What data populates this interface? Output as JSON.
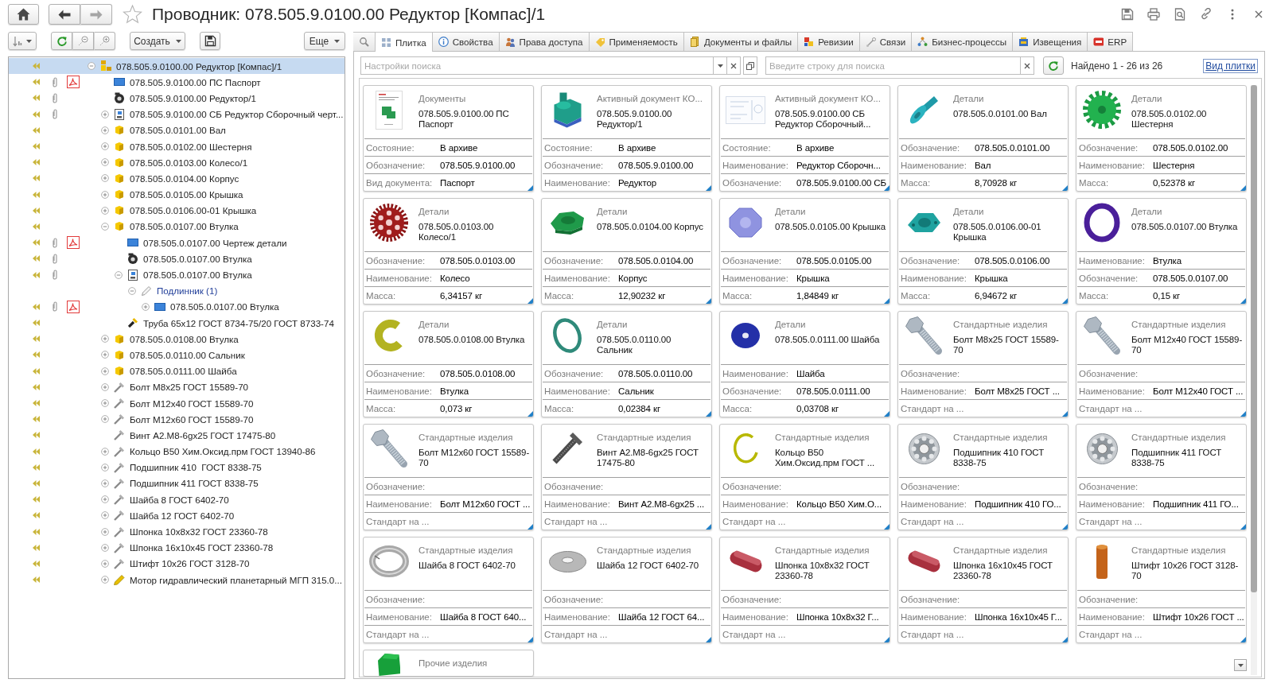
{
  "window": {
    "title": "Проводник: 078.505.9.0100.00 Редуктор [Компас]/1",
    "favorite": false
  },
  "navigation": {
    "back": {
      "disabled": false
    },
    "forward": {
      "disabled": true
    }
  },
  "tree_toolbar": {
    "create_button": "Создать",
    "more_button": "Еще"
  },
  "tree": [
    {
      "label": "078.505.9.0100.00 Редуктор [Компас]/1",
      "kind": "assembly",
      "included": true,
      "selected": true,
      "expanded": true,
      "children": [
        {
          "label": "078.505.9.0100.00 ПС Паспорт",
          "kind": "document",
          "included": true,
          "attachment": true,
          "pdf": true,
          "selected": false
        },
        {
          "label": "078.505.9.0100.00 Редуктор/1",
          "kind": "model",
          "included": true,
          "attachment": true,
          "selected": false
        },
        {
          "label": "078.505.9.0100.00 СБ Редуктор Сборочный черт...",
          "kind": "drawing",
          "included": true,
          "attachment": true,
          "expanded": false,
          "selected": false
        },
        {
          "label": "078.505.0.0101.00 Вал",
          "kind": "part",
          "included": true,
          "expanded": false,
          "selected": false
        },
        {
          "label": "078.505.0.0102.00 Шестерня",
          "kind": "part",
          "included": true,
          "expanded": false,
          "selected": false
        },
        {
          "label": "078.505.0.0103.00 Колесо/1",
          "kind": "part",
          "included": true,
          "expanded": false,
          "selected": false
        },
        {
          "label": "078.505.0.0104.00 Корпус",
          "kind": "part",
          "included": true,
          "expanded": false,
          "selected": false
        },
        {
          "label": "078.505.0.0105.00 Крышка",
          "kind": "part",
          "included": true,
          "expanded": false,
          "selected": false
        },
        {
          "label": "078.505.0.0106.00-01 Крышка",
          "kind": "part",
          "included": true,
          "expanded": false,
          "selected": false
        },
        {
          "label": "078.505.0.0107.00 Втулка",
          "kind": "part",
          "included": true,
          "expanded": true,
          "selected": false,
          "children": [
            {
              "label": "078.505.0.0107.00 Чертеж детали",
              "kind": "document",
              "included": true,
              "attachment": true,
              "pdf": true,
              "selected": false
            },
            {
              "label": "078.505.0.0107.00 Втулка",
              "kind": "model",
              "included": true,
              "attachment": true,
              "selected": false
            },
            {
              "label": "078.505.0.0107.00 Втулка",
              "kind": "drawing",
              "included": true,
              "attachment": true,
              "expanded": true,
              "selected": false,
              "children": [
                {
                  "label": "Подлинник (1)",
                  "kind": "original",
                  "included": false,
                  "expanded": true,
                  "selected": false,
                  "children": [
                    {
                      "label": "078.505.0.0107.00 Втулка",
                      "kind": "document",
                      "included": true,
                      "attachment": true,
                      "pdf": true,
                      "expanded": false,
                      "selected": false
                    }
                  ]
                }
              ]
            },
            {
              "label": "Труба 65х12 ГОСТ 8734-75/20 ГОСТ 8733-74",
              "kind": "material",
              "included": true,
              "selected": false
            }
          ]
        },
        {
          "label": "078.505.0.0108.00 Втулка",
          "kind": "part",
          "included": true,
          "expanded": false,
          "selected": false
        },
        {
          "label": "078.505.0.0110.00 Сальник",
          "kind": "part",
          "included": true,
          "expanded": false,
          "selected": false
        },
        {
          "label": "078.505.0.0111.00 Шайба",
          "kind": "part",
          "included": true,
          "expanded": false,
          "selected": false
        },
        {
          "label": "Болт М8х25 ГОСТ 15589-70",
          "kind": "standard",
          "included": true,
          "expanded": false,
          "selected": false
        },
        {
          "label": "Болт М12х40 ГОСТ 15589-70",
          "kind": "standard",
          "included": true,
          "expanded": false,
          "selected": false
        },
        {
          "label": "Болт М12х60 ГОСТ 15589-70",
          "kind": "standard",
          "included": true,
          "expanded": false,
          "selected": false
        },
        {
          "label": "Винт А2.М8-6gх25 ГОСТ 17475-80",
          "kind": "standard",
          "included": true,
          "selected": false
        },
        {
          "label": "Кольцо В50 Хим.Оксид.прм ГОСТ 13940-86",
          "kind": "standard",
          "included": true,
          "expanded": false,
          "selected": false
        },
        {
          "label": "Подшипник 410  ГОСТ 8338-75",
          "kind": "standard",
          "included": true,
          "expanded": false,
          "selected": false
        },
        {
          "label": "Подшипник 411 ГОСТ 8338-75",
          "kind": "standard",
          "included": true,
          "expanded": false,
          "selected": false
        },
        {
          "label": "Шайба 8 ГОСТ 6402-70",
          "kind": "standard",
          "included": true,
          "expanded": false,
          "selected": false
        },
        {
          "label": "Шайба 12 ГОСТ 6402-70",
          "kind": "standard",
          "included": true,
          "expanded": false,
          "selected": false
        },
        {
          "label": "Шпонка 10х8х32 ГОСТ 23360-78",
          "kind": "standard",
          "included": true,
          "expanded": false,
          "selected": false
        },
        {
          "label": "Шпонка 16х10х45 ГОСТ 23360-78",
          "kind": "standard",
          "included": true,
          "expanded": false,
          "selected": false
        },
        {
          "label": "Штифт 10х26 ГОСТ 3128-70",
          "kind": "standard",
          "included": true,
          "expanded": false,
          "selected": false
        },
        {
          "label": "Мотор гидравлический планетарный МГП 315.0...",
          "kind": "other",
          "included": true,
          "expanded": false,
          "selected": false
        }
      ]
    }
  ],
  "tabs": [
    {
      "kind": "search",
      "selected": false
    },
    {
      "kind": "tiles",
      "label": "Плитка",
      "selected": true
    },
    {
      "kind": "properties",
      "label": "Свойства",
      "selected": false
    },
    {
      "kind": "access",
      "label": "Права доступа",
      "selected": false
    },
    {
      "kind": "usage",
      "label": "Применяемость",
      "selected": false
    },
    {
      "kind": "documents",
      "label": "Документы и файлы",
      "selected": false
    },
    {
      "kind": "revisions",
      "label": "Ревизии",
      "selected": false
    },
    {
      "kind": "links",
      "label": "Связи",
      "selected": false
    },
    {
      "kind": "processes",
      "label": "Бизнес-процессы",
      "selected": false
    },
    {
      "kind": "notices",
      "label": "Извещения",
      "selected": false
    },
    {
      "kind": "erp",
      "label": "ERP",
      "selected": false
    }
  ],
  "search": {
    "settings_field": {
      "placeholder": "Настройки поиска"
    },
    "query_field": {
      "placeholder": "Введите строку для поиска"
    },
    "found": "Найдено 1 - 26 из 26",
    "view_link": "Вид плитки"
  },
  "cards": [
    {
      "kind": "passport",
      "category": "Документы",
      "title": "078.505.9.0100.00 ПС Паспорт",
      "properties": [
        {
          "label": "Состояние:",
          "value": "В архиве"
        },
        {
          "label": "Обозначение:",
          "value": "078.505.9.0100.00"
        },
        {
          "label": "Вид документа:",
          "value": "Паспорт"
        }
      ]
    },
    {
      "kind": "gearbox",
      "category": "Активный документ КО...",
      "title": "078.505.9.0100.00 Редуктор/1",
      "properties": [
        {
          "label": "Состояние:",
          "value": "В архиве"
        },
        {
          "label": "Обозначение:",
          "value": "078.505.9.0100.00"
        },
        {
          "label": "Наименование:",
          "value": "Редуктор"
        }
      ]
    },
    {
      "kind": "blueprint",
      "category": "Активный документ КО...",
      "title": "078.505.9.0100.00 СБ Редуктор Сборочный...",
      "properties": [
        {
          "label": "Состояние:",
          "value": "В архиве"
        },
        {
          "label": "Наименование:",
          "value": "Редуктор Сборочн..."
        },
        {
          "label": "Обозначение:",
          "value": "078.505.9.0100.00 СБ"
        }
      ]
    },
    {
      "kind": "shaft",
      "category": "Детали",
      "title": "078.505.0.0101.00 Вал",
      "properties": [
        {
          "label": "Обозначение:",
          "value": "078.505.0.0101.00"
        },
        {
          "label": "Наименование:",
          "value": "Вал"
        },
        {
          "label": "Масса:",
          "value": "8,70928 кг"
        }
      ]
    },
    {
      "kind": "gear",
      "category": "Детали",
      "title": "078.505.0.0102.00 Шестерня",
      "properties": [
        {
          "label": "Обозначение:",
          "value": "078.505.0.0102.00"
        },
        {
          "label": "Наименование:",
          "value": "Шестерня"
        },
        {
          "label": "Масса:",
          "value": "0,52378 кг"
        }
      ]
    },
    {
      "kind": "wheel",
      "category": "Детали",
      "title": "078.505.0.0103.00 Колесо/1",
      "properties": [
        {
          "label": "Обозначение:",
          "value": "078.505.0.0103.00"
        },
        {
          "label": "Наименование:",
          "value": "Колесо"
        },
        {
          "label": "Масса:",
          "value": "6,34157 кг"
        }
      ]
    },
    {
      "kind": "housing",
      "category": "Детали",
      "title": "078.505.0.0104.00 Корпус",
      "properties": [
        {
          "label": "Обозначение:",
          "value": "078.505.0.0104.00"
        },
        {
          "label": "Наименование:",
          "value": "Корпус"
        },
        {
          "label": "Масса:",
          "value": "12,90232 кг"
        }
      ]
    },
    {
      "kind": "cover",
      "category": "Детали",
      "title": "078.505.0.0105.00 Крышка",
      "properties": [
        {
          "label": "Обозначение:",
          "value": "078.505.0.0105.00"
        },
        {
          "label": "Наименование:",
          "value": "Крышка"
        },
        {
          "label": "Масса:",
          "value": "1,84849 кг"
        }
      ]
    },
    {
      "kind": "flange",
      "category": "Детали",
      "title": "078.505.0.0106.00-01 Крышка",
      "properties": [
        {
          "label": "Обозначение:",
          "value": "078.505.0.0106.00"
        },
        {
          "label": "Наименование:",
          "value": "Крышка"
        },
        {
          "label": "Масса:",
          "value": "6,94672 кг"
        }
      ]
    },
    {
      "kind": "sleeve",
      "category": "Детали",
      "title": "078.505.0.0107.00 Втулка",
      "properties": [
        {
          "label": "Наименование:",
          "value": "Втулка"
        },
        {
          "label": "Обозначение:",
          "value": "078.505.0.0107.00"
        },
        {
          "label": "Масса:",
          "value": "0,15 кг"
        }
      ]
    },
    {
      "kind": "bushing",
      "category": "Детали",
      "title": "078.505.0.0108.00 Втулка",
      "properties": [
        {
          "label": "Обозначение:",
          "value": "078.505.0.0108.00"
        },
        {
          "label": "Наименование:",
          "value": "Втулка"
        },
        {
          "label": "Масса:",
          "value": "0,073 кг"
        }
      ]
    },
    {
      "kind": "seal",
      "category": "Детали",
      "title": "078.505.0.0110.00 Сальник",
      "properties": [
        {
          "label": "Обозначение:",
          "value": "078.505.0.0110.00"
        },
        {
          "label": "Наименование:",
          "value": "Сальник"
        },
        {
          "label": "Масса:",
          "value": "0,02384 кг"
        }
      ]
    },
    {
      "kind": "washer",
      "category": "Детали",
      "title": "078.505.0.0111.00 Шайба",
      "properties": [
        {
          "label": "Наименование:",
          "value": "Шайба"
        },
        {
          "label": "Обозначение:",
          "value": "078.505.0.0111.00"
        },
        {
          "label": "Масса:",
          "value": "0,03708 кг"
        }
      ]
    },
    {
      "kind": "bolt",
      "category": "Стандартные изделия",
      "title": "Болт М8х25 ГОСТ 15589-70",
      "properties": [
        {
          "label": "Обозначение:"
        },
        {
          "label": "Наименование:",
          "value": "Болт М8х25 ГОСТ ..."
        },
        {
          "label": "Стандарт на ..."
        }
      ]
    },
    {
      "kind": "bolt",
      "category": "Стандартные изделия",
      "title": "Болт М12х40 ГОСТ 15589-70",
      "properties": [
        {
          "label": "Обозначение:"
        },
        {
          "label": "Наименование:",
          "value": "Болт М12х40 ГОСТ ..."
        },
        {
          "label": "Стандарт на ..."
        }
      ]
    },
    {
      "kind": "bolt",
      "category": "Стандартные изделия",
      "title": "Болт М12х60 ГОСТ 15589-70",
      "properties": [
        {
          "label": "Обозначение:"
        },
        {
          "label": "Наименование:",
          "value": "Болт М12х60 ГОСТ ..."
        },
        {
          "label": "Стандарт на ..."
        }
      ]
    },
    {
      "kind": "screw",
      "category": "Стандартные изделия",
      "title": "Винт А2.М8-6gх25 ГОСТ 17475-80",
      "properties": [
        {
          "label": "Обозначение:"
        },
        {
          "label": "Наименование:",
          "value": "Винт А2.М8-6gх25 ..."
        },
        {
          "label": "Стандарт на ..."
        }
      ]
    },
    {
      "kind": "circlip",
      "category": "Стандартные изделия",
      "title": "Кольцо В50 Хим.Оксид.прм ГОСТ ...",
      "properties": [
        {
          "label": "Обозначение:"
        },
        {
          "label": "Наименование:",
          "value": "Кольцо В50 Хим.О..."
        },
        {
          "label": "Стандарт на ..."
        }
      ]
    },
    {
      "kind": "bearing",
      "category": "Стандартные изделия",
      "title": "Подшипник 410 ГОСТ 8338-75",
      "properties": [
        {
          "label": "Обозначение:"
        },
        {
          "label": "Наименование:",
          "value": "Подшипник 410 ГО..."
        },
        {
          "label": "Стандарт на ..."
        }
      ]
    },
    {
      "kind": "bearing",
      "category": "Стандартные изделия",
      "title": "Подшипник 411 ГОСТ 8338-75",
      "properties": [
        {
          "label": "Обозначение:"
        },
        {
          "label": "Наименование:",
          "value": "Подшипник 411 ГО..."
        },
        {
          "label": "Стандарт на ..."
        }
      ]
    },
    {
      "kind": "lockwasher",
      "category": "Стандартные изделия",
      "title": "Шайба 8 ГОСТ 6402-70",
      "properties": [
        {
          "label": "Обозначение:"
        },
        {
          "label": "Наименование:",
          "value": "Шайба 8 ГОСТ 640..."
        },
        {
          "label": "Стандарт на ..."
        }
      ]
    },
    {
      "kind": "flatwasher",
      "category": "Стандартные изделия",
      "title": "Шайба 12 ГОСТ 6402-70",
      "properties": [
        {
          "label": "Обозначение:"
        },
        {
          "label": "Наименование:",
          "value": "Шайба 12 ГОСТ 64..."
        },
        {
          "label": "Стандарт на ..."
        }
      ]
    },
    {
      "kind": "key",
      "category": "Стандартные изделия",
      "title": "Шпонка 10х8х32 ГОСТ 23360-78",
      "properties": [
        {
          "label": "Обозначение:"
        },
        {
          "label": "Наименование:",
          "value": "Шпонка 10х8х32 Г..."
        },
        {
          "label": "Стандарт на ..."
        }
      ]
    },
    {
      "kind": "key",
      "category": "Стандартные изделия",
      "title": "Шпонка 16х10х45 ГОСТ 23360-78",
      "properties": [
        {
          "label": "Обозначение:"
        },
        {
          "label": "Наименование:",
          "value": "Шпонка 16х10х45 Г..."
        },
        {
          "label": "Стандарт на ..."
        }
      ]
    },
    {
      "kind": "pin",
      "category": "Стандартные изделия",
      "title": "Штифт 10х26 ГОСТ 3128-70",
      "properties": [
        {
          "label": "Обозначение:"
        },
        {
          "label": "Наименование:",
          "value": "Штифт 10х26 ГОСТ ..."
        },
        {
          "label": "Стандарт на ..."
        }
      ]
    },
    {
      "kind": "bracket",
      "category": "Прочие изделия"
    }
  ]
}
